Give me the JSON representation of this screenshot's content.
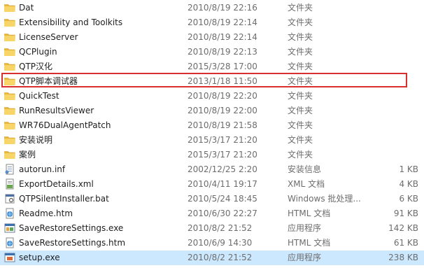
{
  "files": [
    {
      "name": "Dat",
      "date": "2010/8/19 22:16",
      "type": "文件夹",
      "size": "",
      "icon": "folder-icon"
    },
    {
      "name": "Extensibility and Toolkits",
      "date": "2010/8/19 22:14",
      "type": "文件夹",
      "size": "",
      "icon": "folder-icon"
    },
    {
      "name": "LicenseServer",
      "date": "2010/8/19 22:14",
      "type": "文件夹",
      "size": "",
      "icon": "folder-icon"
    },
    {
      "name": "QCPlugin",
      "date": "2010/8/19 22:13",
      "type": "文件夹",
      "size": "",
      "icon": "folder-icon"
    },
    {
      "name": "QTP汉化",
      "date": "2015/3/28 17:00",
      "type": "文件夹",
      "size": "",
      "icon": "folder-icon"
    },
    {
      "name": "QTP脚本调试器",
      "date": "2013/1/18 11:50",
      "type": "文件夹",
      "size": "",
      "icon": "folder-icon"
    },
    {
      "name": "QuickTest",
      "date": "2010/8/19 22:20",
      "type": "文件夹",
      "size": "",
      "icon": "folder-icon"
    },
    {
      "name": "RunResultsViewer",
      "date": "2010/8/19 22:00",
      "type": "文件夹",
      "size": "",
      "icon": "folder-icon"
    },
    {
      "name": "WR76DualAgentPatch",
      "date": "2010/8/19 21:58",
      "type": "文件夹",
      "size": "",
      "icon": "folder-icon"
    },
    {
      "name": "安装说明",
      "date": "2015/3/17 21:20",
      "type": "文件夹",
      "size": "",
      "icon": "folder-icon"
    },
    {
      "name": "案例",
      "date": "2015/3/17 21:20",
      "type": "文件夹",
      "size": "",
      "icon": "folder-icon"
    },
    {
      "name": "autorun.inf",
      "date": "2002/12/25 2:20",
      "type": "安装信息",
      "size": "1 KB",
      "icon": "inf-file-icon"
    },
    {
      "name": "ExportDetails.xml",
      "date": "2010/4/11 19:17",
      "type": "XML 文档",
      "size": "4 KB",
      "icon": "xml-file-icon"
    },
    {
      "name": "QTPSilentInstaller.bat",
      "date": "2010/5/24 18:45",
      "type": "Windows 批处理...",
      "size": "6 KB",
      "icon": "bat-file-icon"
    },
    {
      "name": "Readme.htm",
      "date": "2010/6/30 22:27",
      "type": "HTML 文档",
      "size": "91 KB",
      "icon": "htm-file-icon"
    },
    {
      "name": "SaveRestoreSettings.exe",
      "date": "2010/8/2 21:52",
      "type": "应用程序",
      "size": "142 KB",
      "icon": "exe-file-icon"
    },
    {
      "name": "SaveRestoreSettings.htm",
      "date": "2010/6/9 14:30",
      "type": "HTML 文档",
      "size": "61 KB",
      "icon": "htm-file-icon"
    },
    {
      "name": "setup.exe",
      "date": "2010/8/2 21:52",
      "type": "应用程序",
      "size": "238 KB",
      "icon": "setup-exe-icon"
    }
  ]
}
